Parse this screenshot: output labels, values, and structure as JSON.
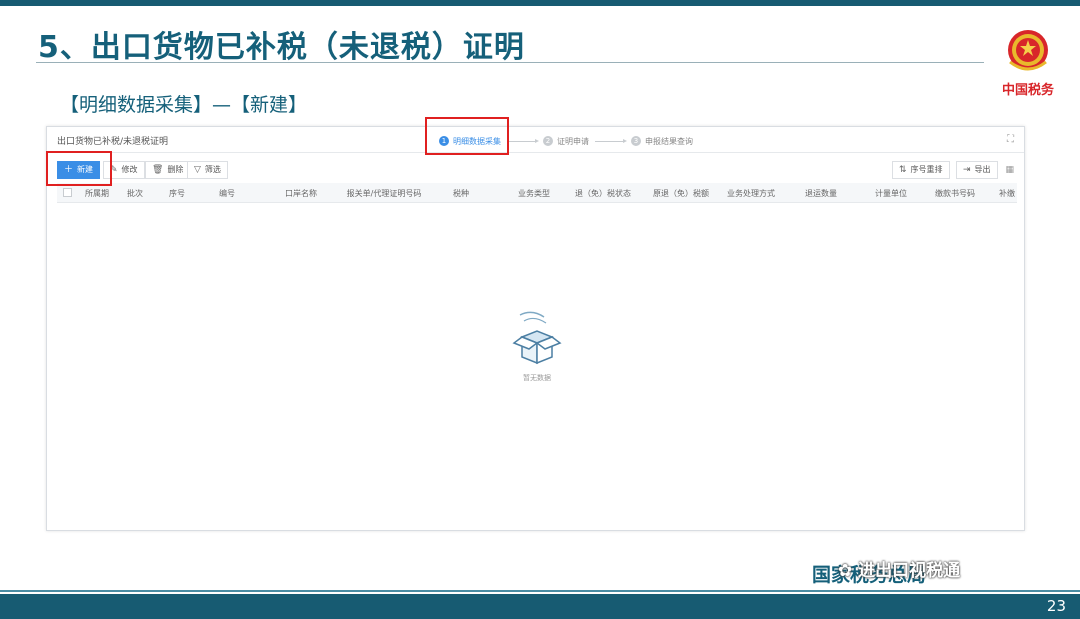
{
  "slide": {
    "title": "5、出口货物已补税（未退税）证明",
    "subtitle": "【明细数据采集】—【新建】",
    "emblem_text": "中国税务",
    "page_number": "23",
    "watermark": "国家税务总局",
    "wechat_overlay": "进出口视税通"
  },
  "window": {
    "breadcrumb": "出口货物已补税/未退税证明",
    "steps": [
      {
        "num": "1",
        "label": "明细数据采集",
        "active": true
      },
      {
        "num": "2",
        "label": "证明申请",
        "active": false
      },
      {
        "num": "3",
        "label": "申报结果查询",
        "active": false
      }
    ],
    "toolbar": {
      "new_label": "新建",
      "edit_label": "修改",
      "delete_label": "删除",
      "filter_label": "筛选",
      "reorder_label": "序号重排",
      "export_label": "导出"
    },
    "columns": [
      "所属期",
      "批次",
      "序号",
      "编号",
      "口岸名称",
      "报关单/代理证明号码",
      "税种",
      "业务类型",
      "退（免）税状态",
      "原退（免）税额",
      "业务处理方式",
      "退运数量",
      "计量单位",
      "缴款书号码",
      "补缴"
    ],
    "empty_text": "暂无数据"
  },
  "colors": {
    "brand": "#15607a",
    "primary": "#3a8ee6",
    "highlight": "#e02020"
  }
}
